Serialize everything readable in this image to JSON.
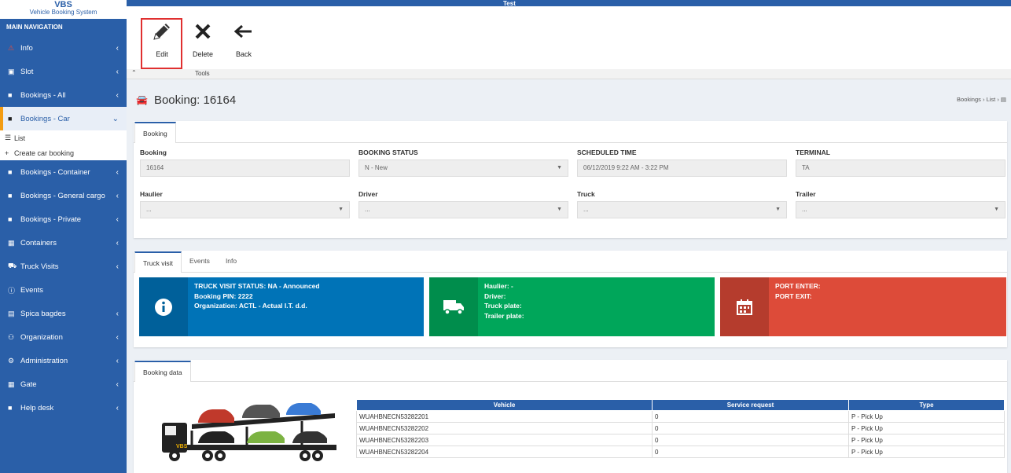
{
  "app": {
    "title": "Test",
    "logo_name": "VBS",
    "logo_sub": "Vehicle Booking System"
  },
  "sidebar": {
    "heading": "MAIN NAVIGATION",
    "items": [
      {
        "label": "Info",
        "icon": "warning-icon"
      },
      {
        "label": "Slot",
        "icon": "calendar-check-icon"
      },
      {
        "label": "Bookings - All",
        "icon": "folder-icon"
      },
      {
        "label": "Bookings - Car",
        "icon": "folder-icon"
      },
      {
        "label": "Bookings - Container",
        "icon": "folder-icon"
      },
      {
        "label": "Bookings - General cargo",
        "icon": "folder-icon"
      },
      {
        "label": "Bookings - Private",
        "icon": "folder-icon"
      },
      {
        "label": "Containers",
        "icon": "grid-icon"
      },
      {
        "label": "Truck Visits",
        "icon": "truck-icon"
      },
      {
        "label": "Events",
        "icon": "info-circle-icon"
      },
      {
        "label": "Spica bagdes",
        "icon": "id-card-icon"
      },
      {
        "label": "Organization",
        "icon": "users-icon"
      },
      {
        "label": "Administration",
        "icon": "cogs-icon"
      },
      {
        "label": "Gate",
        "icon": "grid-icon"
      },
      {
        "label": "Help desk",
        "icon": "folder-icon"
      }
    ],
    "sub": {
      "list": "List",
      "create": "Create car booking"
    }
  },
  "toolbar": {
    "edit": "Edit",
    "delete": "Delete",
    "back": "Back",
    "group": "Tools"
  },
  "page": {
    "title": "Booking: 16164",
    "crumb1": "Bookings",
    "crumb2": "List"
  },
  "booking": {
    "tab": "Booking",
    "fields": [
      {
        "label": "Booking",
        "value": "16164"
      },
      {
        "label": "BOOKING STATUS",
        "value": "N - New"
      },
      {
        "label": "SCHEDULED TIME",
        "value": "06/12/2019 9:22 AM - 3:22 PM"
      },
      {
        "label": "TERMINAL",
        "value": "TA"
      },
      {
        "label": "Haulier",
        "value": "..."
      },
      {
        "label": "Driver",
        "value": "..."
      },
      {
        "label": "Truck",
        "value": "..."
      },
      {
        "label": "Trailer",
        "value": "..."
      }
    ]
  },
  "visit": {
    "tabs": [
      "Truck visit",
      "Events",
      "Info"
    ],
    "tile1": [
      "TRUCK VISIT STATUS: NA - Announced",
      "Booking PIN: 2222",
      "Organization: ACTL - Actual I.T. d.d."
    ],
    "tile2": [
      "Haulier: -",
      "Driver:",
      "Truck plate:",
      "Trailer plate:"
    ],
    "tile3": [
      "PORT ENTER:",
      "PORT EXIT:"
    ],
    "colors": {
      "blue": "#0073b7",
      "green": "#00a65a",
      "red": "#dd4b39"
    }
  },
  "bdata": {
    "tab": "Booking data",
    "headers": [
      "Vehicle",
      "Service request",
      "Type"
    ],
    "rows": [
      [
        "WUAHBNECN53282201",
        "0",
        "P - Pick Up"
      ],
      [
        "WUAHBNECN53282202",
        "0",
        "P - Pick Up"
      ],
      [
        "WUAHBNECN53282203",
        "0",
        "P - Pick Up"
      ],
      [
        "WUAHBNECN53282204",
        "0",
        "P - Pick Up"
      ]
    ],
    "truck_logo": "VBS"
  }
}
